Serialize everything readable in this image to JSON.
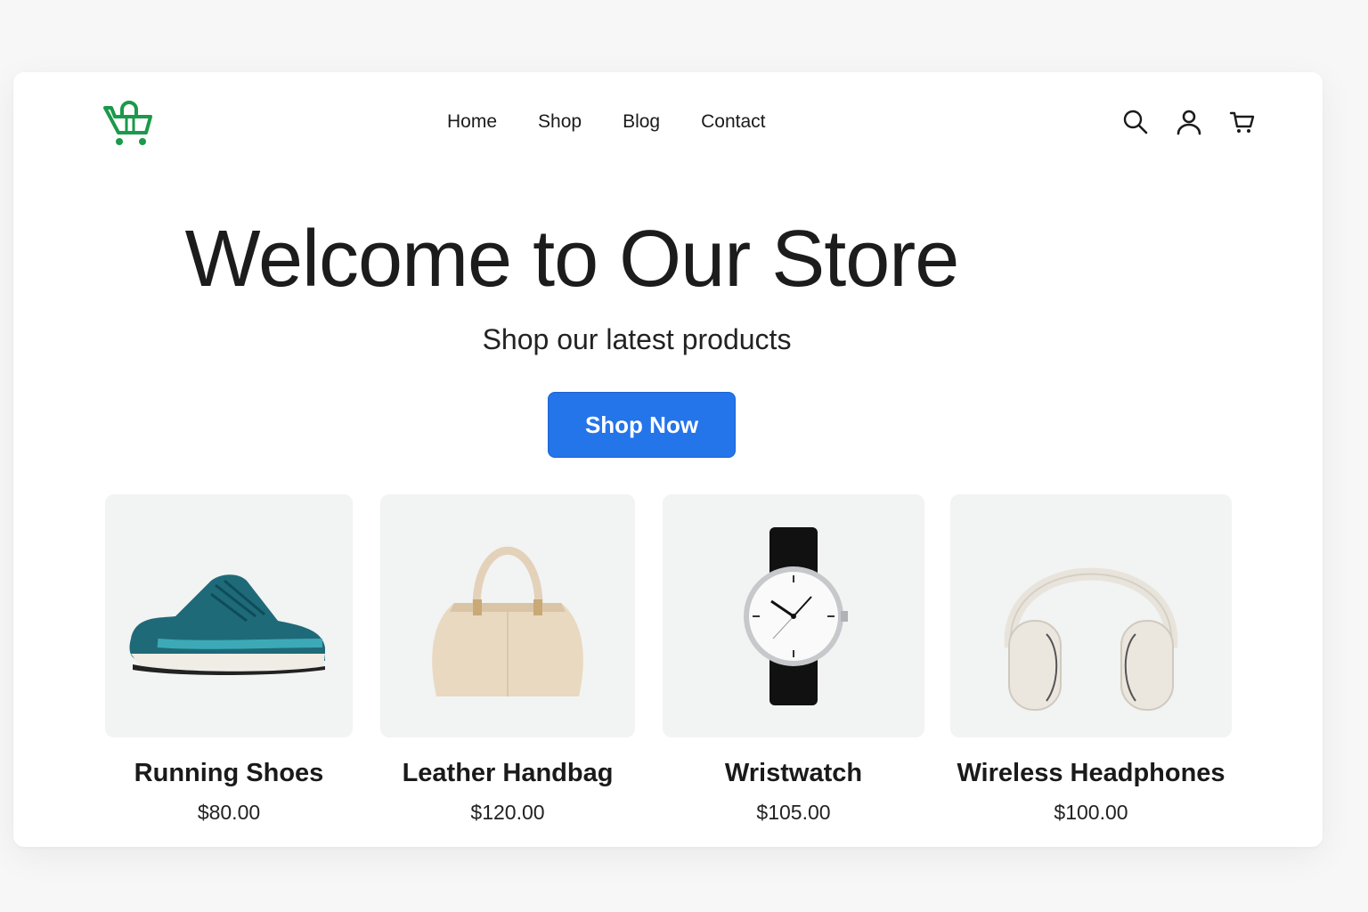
{
  "nav": {
    "links": [
      "Home",
      "Shop",
      "Blog",
      "Contact"
    ]
  },
  "icons": {
    "logo": "shopping-basket-icon",
    "search": "search-icon",
    "account": "user-icon",
    "cart": "cart-icon"
  },
  "colors": {
    "accent": "#2474ea",
    "logo": "#1a9a4a",
    "card_bg": "#f2f3f3"
  },
  "hero": {
    "title": "Welcome to Our Store",
    "subtitle": "Shop our latest products",
    "cta_label": "Shop Now"
  },
  "products": [
    {
      "name": "Running Shoes",
      "price": "$80.00",
      "icon": "sneaker-icon"
    },
    {
      "name": "Leather Handbag",
      "price": "$120.00",
      "icon": "handbag-icon"
    },
    {
      "name": "Wristwatch",
      "price": "$105.00",
      "icon": "watch-icon"
    },
    {
      "name": "Wireless Headphones",
      "price": "$100.00",
      "icon": "headphones-icon"
    }
  ]
}
